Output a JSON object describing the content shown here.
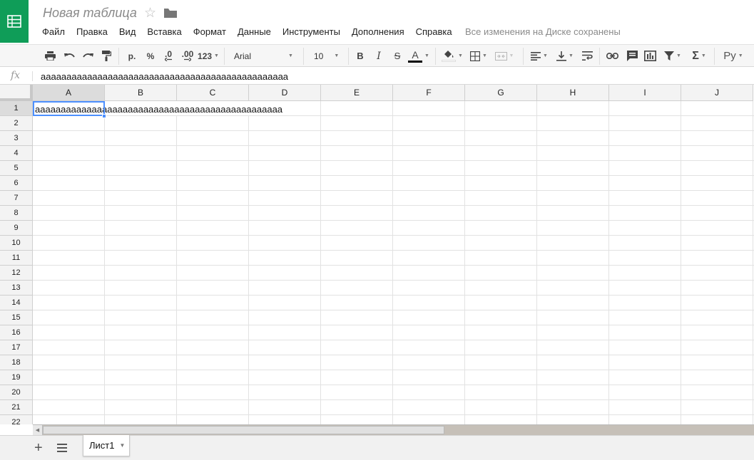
{
  "app": {
    "title": "Новая таблица",
    "save_status": "Все изменения на Диске сохранены",
    "accent_color": "#0f9d58"
  },
  "menu": [
    "Файл",
    "Правка",
    "Вид",
    "Вставка",
    "Формат",
    "Данные",
    "Инструменты",
    "Дополнения",
    "Справка"
  ],
  "toolbar": {
    "currency": "р.",
    "percent": "%",
    "decrease_decimal": ".0",
    "increase_decimal": ".00",
    "more_formats": "123",
    "font": "Arial",
    "font_size": "10",
    "bold": "B",
    "italic": "I",
    "strike": "S",
    "text_color": "A",
    "input_tools": "Ру"
  },
  "formula_bar": {
    "fx_label": "fx",
    "value": "aaaaaaaaaaaaaaaaaaaaaaaaaaaaaaaaaaaaaaaaaaaaaaaa"
  },
  "grid": {
    "columns": [
      "A",
      "B",
      "C",
      "D",
      "E",
      "F",
      "G",
      "H",
      "I",
      "J"
    ],
    "rows": [
      "1",
      "2",
      "3",
      "4",
      "5",
      "6",
      "7",
      "8",
      "9",
      "10",
      "11",
      "12",
      "13",
      "14",
      "15",
      "16",
      "17",
      "18",
      "19",
      "20",
      "21",
      "22"
    ],
    "selected_cell": "A1",
    "a1_value": "aaaaaaaaaaaaaaaaaaaaaaaaaaaaaaaaaaaaaaaaaaaaaaaa"
  },
  "sheets": {
    "tabs": [
      "Лист1"
    ]
  }
}
